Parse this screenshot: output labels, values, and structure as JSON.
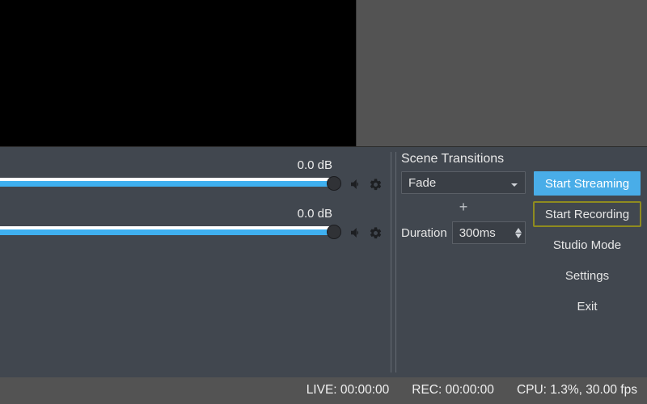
{
  "mixer": {
    "channels": [
      {
        "db_label": "0.0 dB"
      },
      {
        "db_label": "0.0 dB"
      }
    ]
  },
  "transitions": {
    "title": "Scene Transitions",
    "selected": "Fade",
    "add_symbol": "+",
    "duration_label": "Duration",
    "duration_value": "300ms"
  },
  "controls": {
    "start_streaming": "Start Streaming",
    "start_recording": "Start Recording",
    "studio_mode": "Studio Mode",
    "settings": "Settings",
    "exit": "Exit"
  },
  "status": {
    "live": "LIVE: 00:00:00",
    "rec": "REC: 00:00:00",
    "cpu": "CPU: 1.3%, 30.00 fps"
  }
}
